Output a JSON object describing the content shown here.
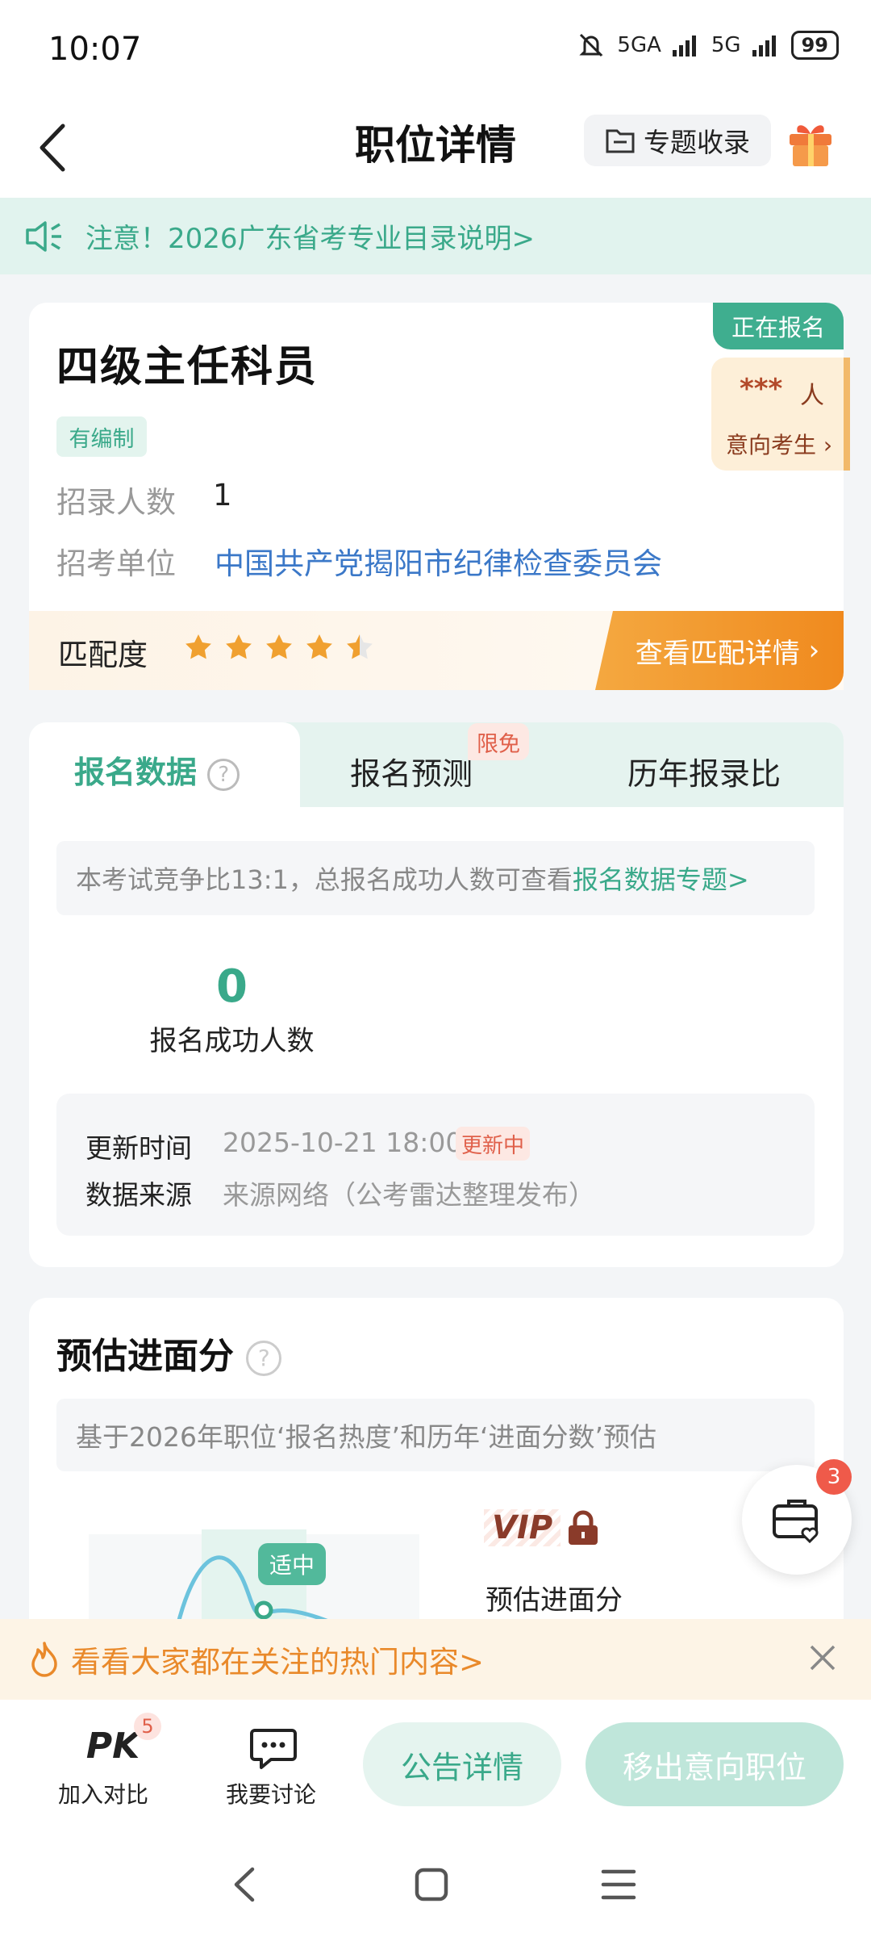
{
  "status": {
    "time": "10:07",
    "net1": "5GA",
    "net2": "5G",
    "battery": "99"
  },
  "nav": {
    "title": "职位详情",
    "collect_label": "专题收录"
  },
  "notice": {
    "text": "注意！2026广东省考专业目录说明>"
  },
  "job": {
    "title": "四级主任科员",
    "status_tag": "正在报名",
    "intent_count": "***",
    "intent_unit": "人",
    "intent_label": "意向考生",
    "bianzhi_tag": "有编制",
    "recruit_label": "招录人数",
    "recruit_value": "1",
    "unit_label": "招考单位",
    "unit_value": "中国共产党揭阳市纪律检查委员会",
    "match_label": "匹配度",
    "match_rating": 4.5,
    "match_max": 5,
    "match_button": "查看匹配详情"
  },
  "data_tabs": {
    "tabs": [
      "报名数据",
      "报名预测",
      "历年报录比"
    ],
    "badge": "限免",
    "tip_text": "本考试竞争比13:1，总报名成功人数可查看",
    "tip_link": "报名数据专题>",
    "count": "0",
    "count_label": "报名成功人数",
    "update_key": "更新时间",
    "update_value": "2025-10-21 18:00",
    "updating_tag": "更新中",
    "source_key": "数据来源",
    "source_value": "来源网络（公考雷达整理发布）"
  },
  "score": {
    "title": "预估进面分",
    "tip": "基于2026年职位‘报名热度’和历年‘进面分数’预估",
    "fit_tag": "适中",
    "vip_label": "VIP",
    "label": "预估进面分"
  },
  "fab": {
    "badge": "3"
  },
  "hot_banner": {
    "text": "看看大家都在关注的热门内容>"
  },
  "bottom": {
    "pk_icon_text": "PK",
    "pk_badge": "5",
    "pk_label": "加入对比",
    "talk_label": "我要讨论",
    "notice_button": "公告详情",
    "remove_button": "移出意向职位"
  },
  "colors": {
    "accent": "#3aa98a",
    "orange": "#f08a1e",
    "red": "#e0604a"
  }
}
